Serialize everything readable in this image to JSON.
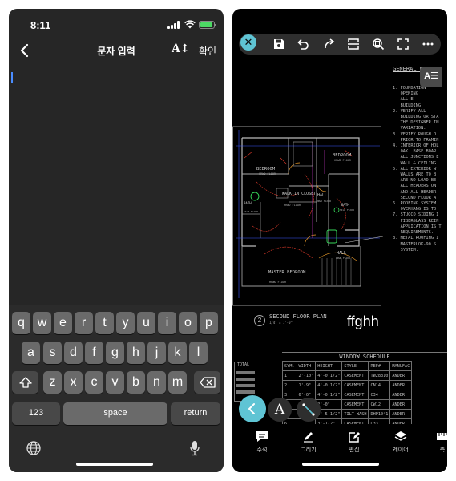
{
  "left_screen": {
    "status": {
      "time": "8:11"
    },
    "nav": {
      "title": "문자 입력",
      "font_button": "A↕",
      "confirm": "확인"
    },
    "keyboard": {
      "row1": [
        "q",
        "w",
        "e",
        "r",
        "t",
        "y",
        "u",
        "i",
        "o",
        "p"
      ],
      "row2": [
        "a",
        "s",
        "d",
        "f",
        "g",
        "h",
        "j",
        "k",
        "l"
      ],
      "row3": [
        "z",
        "x",
        "c",
        "v",
        "b",
        "n",
        "m"
      ],
      "numbers_key": "123",
      "space_key": "space",
      "return_key": "return"
    }
  },
  "right_screen": {
    "toolbar": {
      "icons": [
        "close-icon",
        "save-icon",
        "undo-icon",
        "redo-icon",
        "scan-icon",
        "zoom-icon",
        "fullscreen-icon",
        "more-icon"
      ],
      "text_align_button": "A☰"
    },
    "drawing": {
      "general_notes_title": "GENERAL NOTES",
      "general_notes_text": "1. FOUNDATION\n   OPENING\n   ALL E\n   BUILDING\n2. VERIFY ALL\n   BUILDING OR STA\n   THE DESIGNER IM\n   VARIATION.\n3. VERIFY ROUGH O\n   PRIOR TO FRAMIN\n4. INTERIOR OF HOL\n   OAK. BASE BOAR\n   ALL JUNCTIONS E\n   WALL & CEILING\n5. ALL EXTERIOR W\n   WALLS ARE TO B\n   ARE NO LOAD BE\n   ALL HEADERS ON\n   AND ALL HEADER\n   SECOND FLOOR A\n6. ROOFING SYSTEM\n   OVERHANG IS TO\n7. STUCCO SIDING I\n   FIBERGLASS REIN\n   APPLICATION IS T\n   REQUIREMENTS.\n8. METAL ROOFING I\n   MASTERLOK-90 S\n   SYSTEM.",
      "rooms": [
        {
          "name": "BEDROOM",
          "floor": "HRWD FLOOR"
        },
        {
          "name": "BEDROOM",
          "floor": "HRWD FLOOR"
        },
        {
          "name": "WALK-IN CLOSET",
          "floor": "HRWD FLOOR"
        },
        {
          "name": "HALL",
          "floor": "HRWD FLOOR"
        },
        {
          "name": "BATH",
          "floor": "TILE FLOOR"
        },
        {
          "name": "BATH",
          "floor": "TILE FLOOR"
        },
        {
          "name": "HALL",
          "floor": "HRWD FLOOR"
        },
        {
          "name": "MASTER BEDROOM",
          "floor": "HRWD FLOOR"
        }
      ],
      "floor_plan_number": "2",
      "floor_plan_title": "SECOND FLOOR PLAN",
      "floor_plan_scale": "1/4\" = 1'-0\"",
      "typed_text": "ffghh",
      "total_label": "TOTAL",
      "window_schedule": {
        "title": "WINDOW SCHEDULE",
        "headers": [
          "SYM.",
          "WIDTH",
          "HEIGHT",
          "STYLE",
          "REF#",
          "MANUFAC"
        ],
        "rows": [
          [
            "1",
            "2'-10\"",
            "4'-0 1/2\"",
            "CASEMENT",
            "TW28310",
            "ANDER"
          ],
          [
            "2",
            "1'-9\"",
            "4'-0 1/2\"",
            "CASEMENT",
            "CN14",
            "ANDER"
          ],
          [
            "3",
            "6'-0\"",
            "4'-0 1/2\"",
            "CASEMENT",
            "C34",
            "ANDER"
          ],
          [
            "4",
            "",
            "2'-0\"",
            "CASEMENT",
            "CW12",
            "ANDER"
          ],
          [
            "5",
            "",
            "4'-5 1/2\"",
            "TILT-WASH",
            "DHP1041",
            "ANDER"
          ],
          [
            "6",
            "",
            "3'-1/2\"",
            "CASEMENT",
            "C33",
            "ANDER"
          ]
        ]
      }
    },
    "fab": {
      "text_tool": "A"
    },
    "tabs": [
      {
        "label": "주석",
        "icon": "comment-icon"
      },
      {
        "label": "그리기",
        "icon": "pencil-icon"
      },
      {
        "label": "편집",
        "icon": "edit-icon"
      },
      {
        "label": "레이어",
        "icon": "layers-icon"
      },
      {
        "label": "측",
        "icon": "ruler-icon"
      }
    ]
  }
}
